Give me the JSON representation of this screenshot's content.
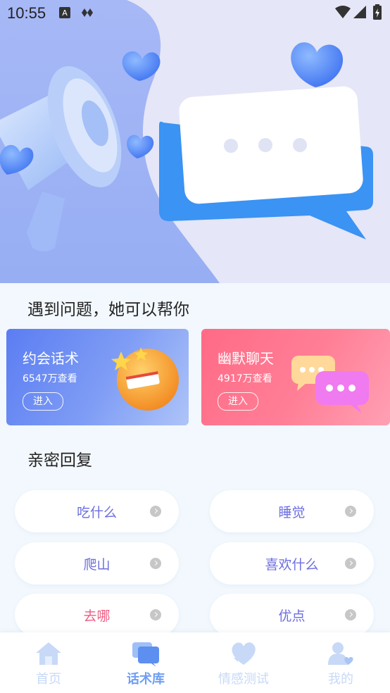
{
  "status_bar": {
    "time": "10:55"
  },
  "section_help": {
    "title": "遇到问题，她可以帮你"
  },
  "cards": [
    {
      "title": "约会话术",
      "views": "6547万查看",
      "enter_label": "进入"
    },
    {
      "title": "幽默聊天",
      "views": "4917万查看",
      "enter_label": "进入"
    }
  ],
  "section_replies": {
    "title": "亲密回复"
  },
  "replies": [
    {
      "label": "吃什么"
    },
    {
      "label": "睡觉"
    },
    {
      "label": "爬山"
    },
    {
      "label": "喜欢什么"
    },
    {
      "label": "去哪"
    },
    {
      "label": "优点"
    }
  ],
  "tabs": [
    {
      "label": "首页",
      "icon": "home-icon"
    },
    {
      "label": "话术库",
      "icon": "chat-icon"
    },
    {
      "label": "情感测试",
      "icon": "heart-icon"
    },
    {
      "label": "我的",
      "icon": "user-icon"
    }
  ],
  "colors": {
    "accent": "#6f9ef2",
    "card_blue": "#5b7df2",
    "card_pink": "#ff6a86",
    "reply_text": "#6c6ee0",
    "reply_text_highlight": "#ef5c83"
  }
}
